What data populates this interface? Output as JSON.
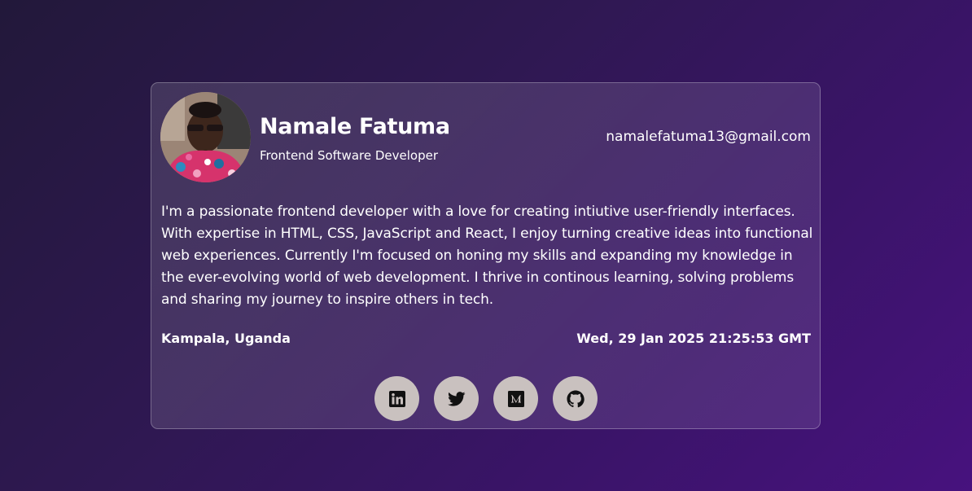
{
  "profile": {
    "name": "Namale Fatuma",
    "role": "Frontend Software Developer",
    "email": "namalefatuma13@gmail.com",
    "bio": "I'm a passionate frontend developer with a love for creating intiutive user-friendly interfaces. With expertise in HTML, CSS, JavaScript and React, I enjoy turning creative ideas into functional web experiences. Currently I'm focused on honing my skills and expanding my knowledge in the ever-evolving world of web development. I thrive in continous learning, solving problems and sharing my journey to inspire others in tech.",
    "location": "Kampala, Uganda",
    "datetime": "Wed, 29 Jan 2025 21:25:53 GMT"
  },
  "socials": [
    {
      "icon": "linkedin-icon"
    },
    {
      "icon": "twitter-icon"
    },
    {
      "icon": "medium-icon"
    },
    {
      "icon": "github-icon"
    }
  ],
  "colors": {
    "background_start": "#22183a",
    "background_end": "#47127e",
    "social_button": "#c9c1bf",
    "text": "#ffffff"
  }
}
